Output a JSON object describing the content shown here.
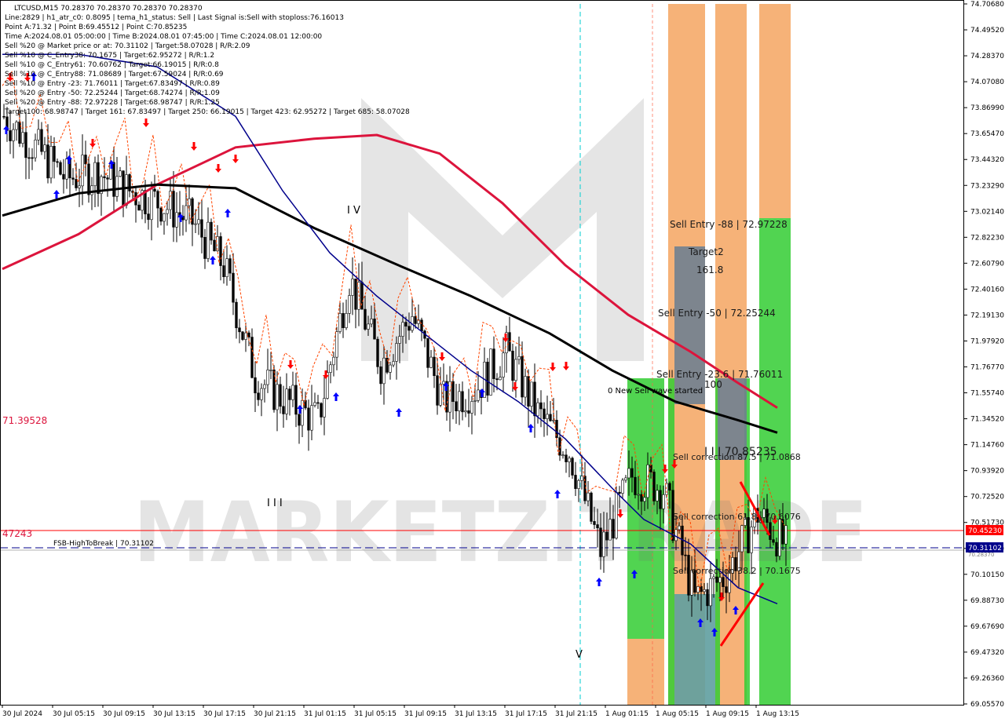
{
  "header_lines": [
    "LTCUSD,M15  70.28370 70.28370 70.28370 70.28370",
    "Line:2829 | h1_atr_c0: 0.8095 | tema_h1_status: Sell | Last Signal is:Sell with stoploss:76.16013",
    "Point A:71.32 | Point B:69.45512 | Point C:70.85235",
    "Time A:2024.08.01 05:00:00 | Time B:2024.08.01 07:45:00 | Time C:2024.08.01 12:00:00",
    "Sell %20 @ Market price or at: 70.31102 | Target:58.07028 | R/R:2.09",
    "Sell %10 @ C_Entry38: 70.1675 | Target:62.95272 | R/R:1.2",
    "Sell %10 @ C_Entry61: 70.60762 | Target:66.19015 | R/R:0.8",
    "Sell %10 @ C_Entry88: 71.08689 | Target:67.59024 | R/R:0.69",
    "Sell %10 @ Entry -23: 71.76011 | Target:67.83497 | R/R:0.89",
    "Sell %20 @ Entry -50: 72.25244 | Target:68.74274 | R/R:1.09",
    "Sell %20 @ Entry -88: 72.97228 | Target:68.98747 | R/R:1.25",
    "Target100: 68.98747 | Target 161: 67.83497 | Target 250: 66.19015 | Target 423: 62.95272 | Target 685: 58.07028"
  ],
  "price_axis": [
    "74.70680",
    "74.49520",
    "74.28370",
    "74.07080",
    "73.86990",
    "73.65470",
    "73.44320",
    "73.23290",
    "73.02140",
    "72.82230",
    "72.60790",
    "72.40160",
    "72.19130",
    "71.97920",
    "71.76770",
    "71.55740",
    "71.34520",
    "71.14760",
    "70.93920",
    "70.72520",
    "70.51730",
    "70.30370",
    "70.10150",
    "69.88730",
    "69.67690",
    "69.47320",
    "69.26360",
    "69.05570"
  ],
  "time_axis": [
    "30 Jul 2024",
    "30 Jul 05:15",
    "30 Jul 09:15",
    "30 Jul 13:15",
    "30 Jul 17:15",
    "30 Jul 21:15",
    "31 Jul 01:15",
    "31 Jul 05:15",
    "31 Jul 09:15",
    "31 Jul 13:15",
    "31 Jul 17:15",
    "31 Jul 21:15",
    "1 Aug 01:15",
    "1 Aug 05:15",
    "1 Aug 09:15",
    "1 Aug 13:15"
  ],
  "current_price_tag": "70.45230",
  "market_price_tag": "70.31102",
  "market_price_tag2": "70.28370",
  "colors": {
    "bg": "#ffffff",
    "bull": "#000000",
    "bear": "#000000",
    "ma_red": "#dc143c",
    "ma_black": "#000000",
    "ma_blue": "#00008b",
    "stop_line": "#ff4500",
    "price_line": "#ff0000",
    "market_line": "#00008b",
    "zone_orange": "#f4a460",
    "zone_green": "#32cd32",
    "zone_grey": "#708090",
    "zone_teal": "#5f9ea0"
  },
  "labels": {
    "left_level": "71.39528",
    "left_level2": "47243",
    "fsb": "FSB-HighToBreak | 70.31102",
    "wave_iv": "I V",
    "wave_iii": "I I I",
    "wave_v": "V",
    "sell_entry_88": "Sell Entry -88 | 72.97228",
    "target2": "Target2",
    "fib_1618": "161.8",
    "sell_entry_50": "Sell Entry -50 | 72.25244",
    "sell_entry_23": "Sell Entry -23.6 | 71.76011",
    "new_sell_wave": "0 New Sell wave started",
    "target_100": "100",
    "point_c": "I I I 70.85235",
    "corr_875": "Sell correction 87.5 | 71.0868",
    "corr_618": "Sell correction 61.8 | 70.6076",
    "corr_382": "Sell correction 38.2 | 70.1675",
    "watermark": "MARKETZITRADE"
  },
  "chart_data": {
    "type": "candlestick",
    "symbol": "LTCUSD",
    "timeframe": "M15",
    "ylim": [
      69.0557,
      74.7068
    ],
    "x_labels": [
      "30 Jul 2024",
      "30 Jul 05:15",
      "30 Jul 09:15",
      "30 Jul 13:15",
      "30 Jul 17:15",
      "30 Jul 21:15",
      "31 Jul 01:15",
      "31 Jul 05:15",
      "31 Jul 09:15",
      "31 Jul 13:15",
      "31 Jul 17:15",
      "31 Jul 21:15",
      "1 Aug 01:15",
      "1 Aug 05:15",
      "1 Aug 09:15",
      "1 Aug 13:15"
    ],
    "close_path": [
      [
        0,
        73.8
      ],
      [
        10,
        73.55
      ],
      [
        20,
        73.3
      ],
      [
        30,
        73.35
      ],
      [
        40,
        73.2
      ],
      [
        50,
        73.1
      ],
      [
        60,
        72.95
      ],
      [
        70,
        72.6
      ],
      [
        80,
        71.7
      ],
      [
        90,
        71.5
      ],
      [
        100,
        71.35
      ],
      [
        110,
        72.5
      ],
      [
        120,
        71.8
      ],
      [
        130,
        72.2
      ],
      [
        140,
        71.5
      ],
      [
        150,
        71.6
      ],
      [
        160,
        71.9
      ],
      [
        170,
        71.4
      ],
      [
        180,
        71.1
      ],
      [
        190,
        70.3
      ],
      [
        200,
        70.9
      ],
      [
        210,
        70.8
      ],
      [
        220,
        69.9
      ],
      [
        230,
        70.1
      ],
      [
        240,
        70.6
      ],
      [
        250,
        70.3
      ]
    ],
    "levels": {
      "current": 70.4523,
      "market": 70.31102,
      "ask": 70.2837,
      "left_level": 71.39528,
      "point_a": 71.32,
      "point_b": 69.45512,
      "point_c": 70.85235,
      "stoploss": 76.16013
    }
  }
}
